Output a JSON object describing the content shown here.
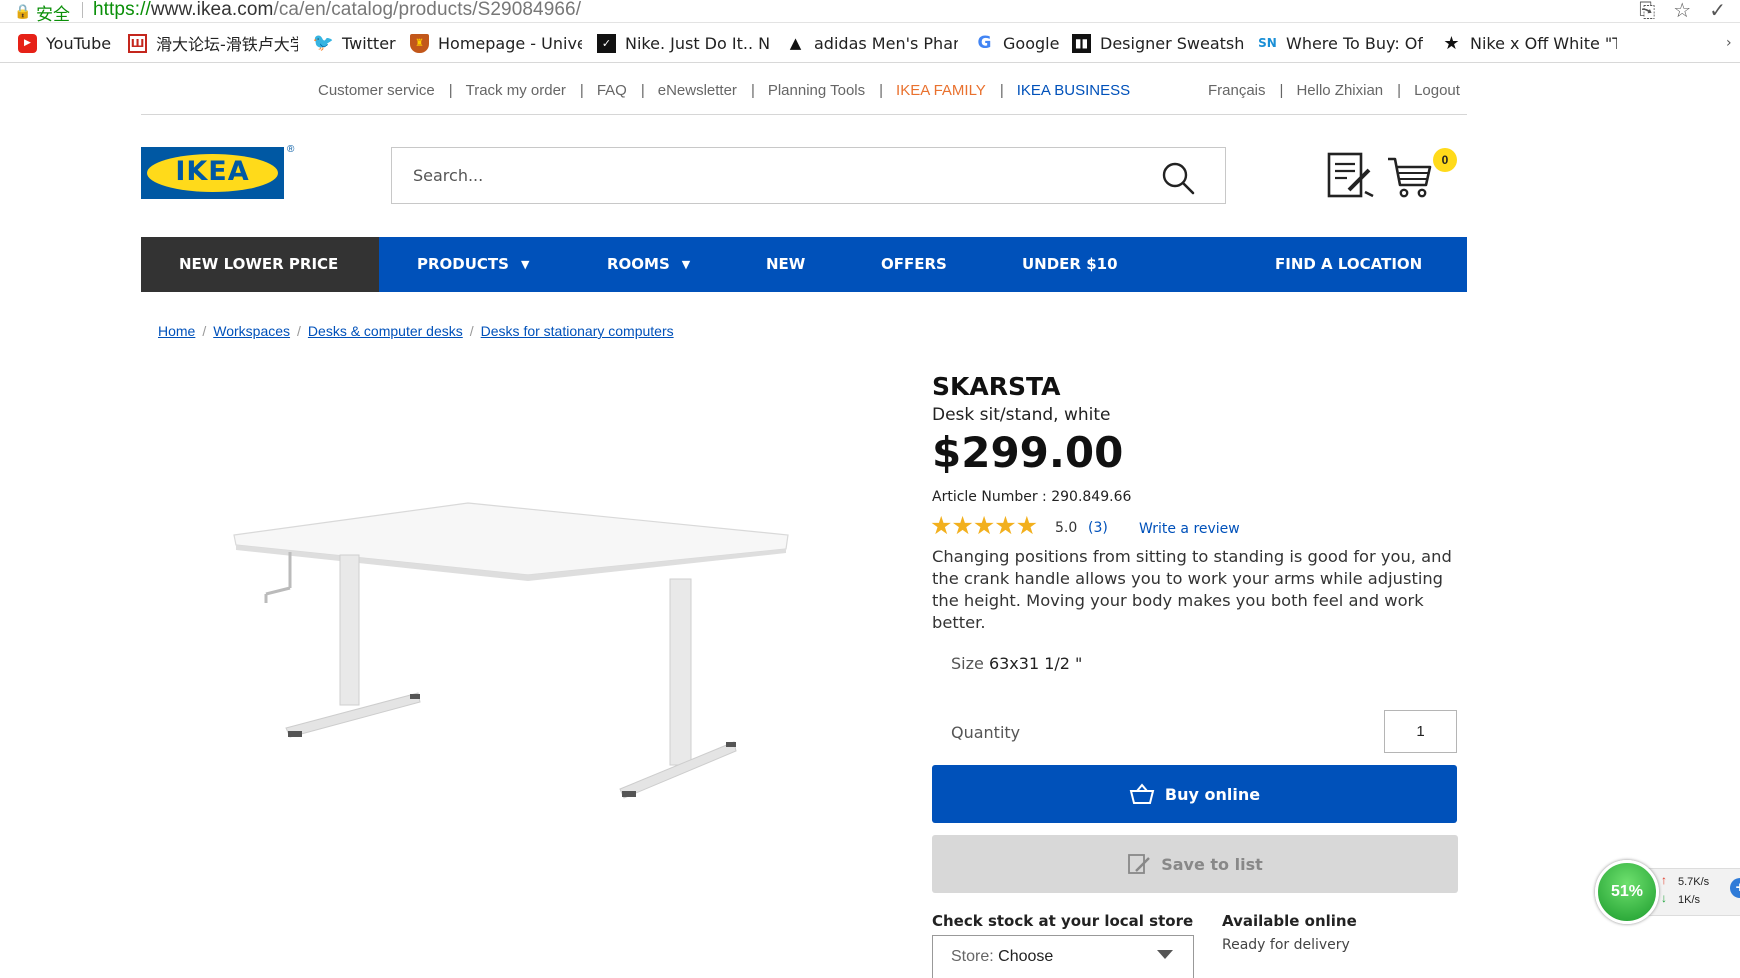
{
  "browser": {
    "secure_label": "安全",
    "url_scheme": "https://",
    "url_host": "www.ikea.com",
    "url_path": "/ca/en/catalog/products/S29084966/",
    "bookmarks": [
      {
        "label": "YouTube",
        "icon": "youtube-icon"
      },
      {
        "label": "滑大论坛-滑铁卢大学",
        "icon": "forum-icon"
      },
      {
        "label": "Twitter",
        "icon": "twitter-icon"
      },
      {
        "label": "Homepage - Univer",
        "icon": "university-crest-icon"
      },
      {
        "label": "Nike. Just Do It.. Nil",
        "icon": "nike-icon"
      },
      {
        "label": "adidas Men's Pharr",
        "icon": "adidas-icon"
      },
      {
        "label": "Google",
        "icon": "google-icon"
      },
      {
        "label": "Designer Sweatshirt",
        "icon": "designer-icon"
      },
      {
        "label": "Where To Buy: Off-",
        "icon": "sn-icon"
      },
      {
        "label": "Nike x Off White \"T",
        "icon": "star-icon"
      }
    ]
  },
  "util_nav": {
    "left": [
      "Customer service",
      "Track my order",
      "FAQ",
      "eNewsletter",
      "Planning Tools",
      "IKEA FAMILY",
      "IKEA BUSINESS"
    ],
    "right": [
      "Français",
      "Hello Zhixian",
      "Logout"
    ]
  },
  "header": {
    "logo_text": "IKEA",
    "search_placeholder": "Search...",
    "cart_count": "0"
  },
  "main_nav": [
    "NEW LOWER PRICE",
    "PRODUCTS",
    "ROOMS",
    "NEW",
    "OFFERS",
    "UNDER $10",
    "FIND A LOCATION"
  ],
  "breadcrumb": [
    "Home",
    "Workspaces",
    "Desks & computer desks",
    "Desks for stationary computers"
  ],
  "product": {
    "name": "SKARSTA",
    "subtitle": "Desk sit/stand, white",
    "price": "$299.00",
    "article_label": "Article Number : 290.849.66",
    "stars_value": 5,
    "stars": "★★★★★",
    "rating": "5.0",
    "review_count": "(3)",
    "write_review": "Write a review",
    "description": "Changing positions from sitting to standing is good for you, and the crank handle allows you to work your arms while adjusting the height. Moving your body makes you both feel and work better.",
    "size_label": "Size",
    "size_value": "63x31 1/2 \"",
    "quantity_label": "Quantity",
    "quantity_value": "1",
    "buy_label": "Buy online",
    "save_label": "Save to list",
    "stock_label": "Check stock at your local store",
    "store_key": "Store:",
    "store_value": "Choose",
    "available_label": "Available online",
    "available_sub": "Ready for delivery"
  },
  "net_widget": {
    "percent": "51%",
    "up": "5.7K/s",
    "down": "1K/s"
  },
  "colors": {
    "ikea_blue": "#0051ba",
    "ikea_yellow": "#ffda1a",
    "family_orange": "#e9712e",
    "star_gold": "#f2b01e"
  }
}
